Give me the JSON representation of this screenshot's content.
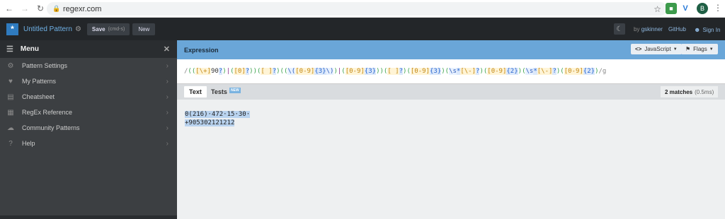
{
  "browser": {
    "url": "regexr.com",
    "avatar_letter": "B"
  },
  "header": {
    "title": "Untitled Pattern",
    "save_label": "Save",
    "save_shortcut": "(cmd-s)",
    "new_label": "New",
    "by_label": "by",
    "author": "gskinner",
    "github_label": "GitHub",
    "signin_label": "Sign In"
  },
  "sidebar": {
    "menu_label": "Menu",
    "items": [
      {
        "label": "Pattern Settings",
        "icon": "gear-icon"
      },
      {
        "label": "My Patterns",
        "icon": "heart-icon"
      },
      {
        "label": "Cheatsheet",
        "icon": "document-icon"
      },
      {
        "label": "RegEx Reference",
        "icon": "book-icon"
      },
      {
        "label": "Community Patterns",
        "icon": "cloud-icon"
      },
      {
        "label": "Help",
        "icon": "help-icon"
      }
    ]
  },
  "expression": {
    "heading": "Expression",
    "flavor_label": "JavaScript",
    "flags_label": "Flags",
    "regex": "/(([\\+]90?)|([0]?))([ ]?)((\\([0-9]{3}\\))|([0-9]{3}))([ ]?)([0-9]{3})(\\s*[\\-]?)([0-9]{2})(\\s*[\\-]?)([0-9]{2})/g"
  },
  "text_panel": {
    "tab_text": "Text",
    "tab_tests": "Tests",
    "new_badge": "NEW",
    "matches_label": "2 matches",
    "matches_time": "(0.5ms)",
    "lines": [
      "0(216)·472·15·30·",
      "+905302121212"
    ]
  },
  "colors": {
    "header_bg": "#232629",
    "sidebar_bg": "#3c3f42",
    "expression_header": "#6aa6d8",
    "match_highlight": "#b9d3ef"
  }
}
